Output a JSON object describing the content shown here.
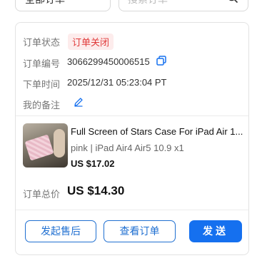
{
  "filters": {
    "status_value": "全部订单",
    "search_placeholder": "搜索订单"
  },
  "order": {
    "status_label": "订单状态",
    "status_value": "订单关闭",
    "number_label": "订单编号",
    "number_value": "3066299450006515",
    "time_label": "下单时间",
    "time_value": "2025/12/31 05:23:04 PT",
    "note_label": "我的备注"
  },
  "product": {
    "title": "Full Screen of Stars Case For iPad Air 1...",
    "variant": "pink | iPad Air4 Air5 10.9 x1",
    "price": "US $17.02"
  },
  "summary": {
    "total_label": "订单总价",
    "total_value": "US $14.30"
  },
  "actions": {
    "after_sales": "发起售后",
    "view_order": "查看订单",
    "ship": "发送"
  },
  "colors": {
    "accent": "#1570ef",
    "status_closed_bg": "#fdecec",
    "status_closed_text": "#e03a3a"
  }
}
